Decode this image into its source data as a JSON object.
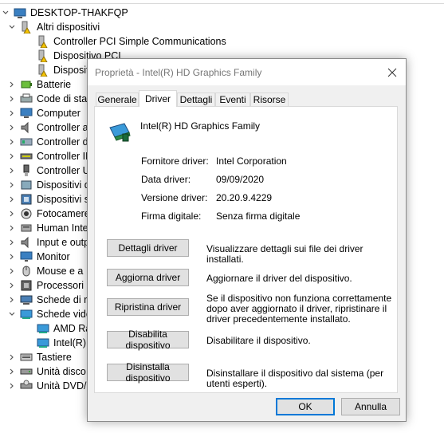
{
  "tree": {
    "computer": "DESKTOP-THAKFQP",
    "items": [
      {
        "label": "Altri dispositivi",
        "expanded": true,
        "icon": "warning-device-icon"
      },
      {
        "label": "Controller PCI Simple Communications",
        "child": true,
        "icon": "warning-device-icon"
      },
      {
        "label": "Dispositivo PCI",
        "child": true,
        "icon": "warning-device-icon"
      },
      {
        "label": "Dispositi",
        "child": true,
        "icon": "warning-device-icon"
      },
      {
        "label": "Batterie",
        "icon": "battery-icon"
      },
      {
        "label": "Code di star",
        "icon": "print-queue-icon"
      },
      {
        "label": "Computer",
        "icon": "computer-icon"
      },
      {
        "label": "Controller a",
        "icon": "audio-controller-icon"
      },
      {
        "label": "Controller d",
        "icon": "storage-controller-icon"
      },
      {
        "label": "Controller ID",
        "icon": "ide-controller-icon"
      },
      {
        "label": "Controller U",
        "icon": "usb-controller-icon"
      },
      {
        "label": "Dispositivi d",
        "icon": "hid-device-icon"
      },
      {
        "label": "Dispositivi s",
        "icon": "system-device-icon"
      },
      {
        "label": "Fotocamere",
        "icon": "camera-icon"
      },
      {
        "label": "Human Inte",
        "icon": "human-interface-icon"
      },
      {
        "label": "Input e outp",
        "icon": "audio-io-icon"
      },
      {
        "label": "Monitor",
        "icon": "monitor-icon"
      },
      {
        "label": "Mouse e a",
        "icon": "mouse-icon"
      },
      {
        "label": "Processori",
        "icon": "processor-icon"
      },
      {
        "label": "Schede di re",
        "icon": "network-adapter-icon"
      },
      {
        "label": "Schede vide",
        "expanded": true,
        "icon": "display-adapter-icon"
      },
      {
        "label": "AMD Ra",
        "child": true,
        "icon": "display-adapter-icon"
      },
      {
        "label": "Intel(R)",
        "child": true,
        "icon": "display-adapter-icon"
      },
      {
        "label": "Tastiere",
        "icon": "keyboard-icon"
      },
      {
        "label": "Unità disco",
        "icon": "disk-drive-icon"
      },
      {
        "label": "Unità DVD/C",
        "icon": "dvd-drive-icon"
      }
    ]
  },
  "dialog": {
    "title": "Proprietà - Intel(R) HD Graphics Family",
    "tabs": [
      "Generale",
      "Driver",
      "Dettagli",
      "Eventi",
      "Risorse"
    ],
    "active_tab": "Driver",
    "device_name": "Intel(R) HD Graphics Family",
    "fields": [
      {
        "label": "Fornitore driver:",
        "value": "Intel Corporation"
      },
      {
        "label": "Data driver:",
        "value": "09/09/2020"
      },
      {
        "label": "Versione driver:",
        "value": "20.20.9.4229"
      },
      {
        "label": "Firma digitale:",
        "value": "Senza firma digitale"
      }
    ],
    "actions": [
      {
        "button": "Dettagli driver",
        "description": "Visualizzare dettagli sui file dei driver installati."
      },
      {
        "button": "Aggiorna driver",
        "description": "Aggiornare il driver del dispositivo."
      },
      {
        "button": "Ripristina driver",
        "description": "Se il dispositivo non funziona correttamente dopo aver aggiornato il driver, ripristinare il driver precedentemente installato."
      },
      {
        "button": "Disabilita dispositivo",
        "description": "Disabilitare il dispositivo."
      },
      {
        "button": "Disinstalla dispositivo",
        "description": "Disinstallare il dispositivo dal sistema (per utenti esperti)."
      }
    ],
    "ok_label": "OK",
    "cancel_label": "Annulla"
  }
}
